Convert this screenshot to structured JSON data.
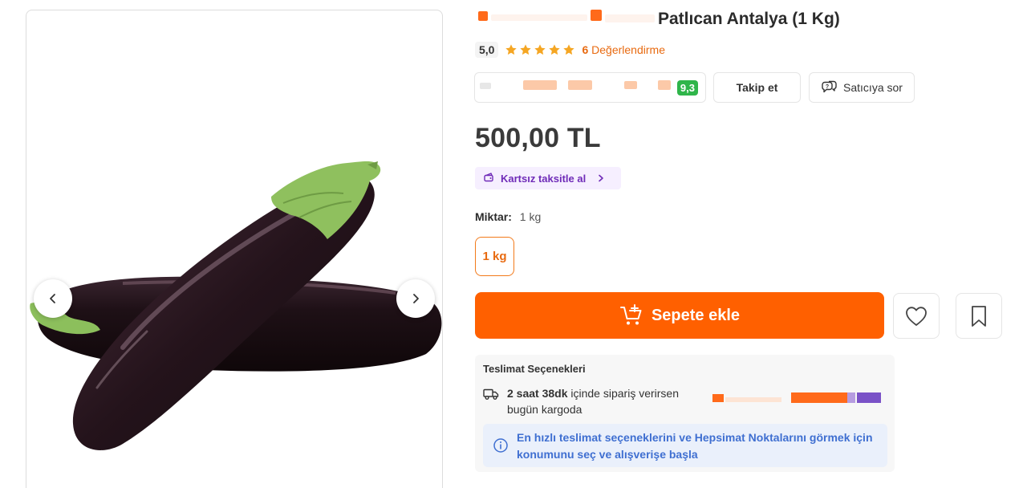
{
  "product": {
    "title": "Patlıcan Antalya (1 Kg)",
    "rating_score": "5,0",
    "rating_stars": 5,
    "review_count": "6",
    "review_label": "Değerlendirme",
    "price": "500,00 TL"
  },
  "seller": {
    "score": "9,3",
    "follow_label": "Takip et",
    "ask_label": "Satıcıya sor"
  },
  "installment": {
    "label": "Kartsız taksitle al"
  },
  "quantity": {
    "label": "Miktar:",
    "value": "1 kg",
    "options": [
      "1 kg"
    ]
  },
  "cart": {
    "add_label": "Sepete ekle"
  },
  "delivery": {
    "title": "Teslimat Seçenekleri",
    "time_bold": "2 saat 38dk",
    "time_rest": "içinde sipariş verirsen",
    "time_line2": "bugün kargoda",
    "info_part1": "En hızlı teslimat seçeneklerini ve ",
    "info_link": "Hepsimat Noktalarını",
    "info_part2": " görmek için",
    "info_line2": "konumunu seç ve alışverişe başla"
  },
  "colors": {
    "accent": "#ff6000",
    "star": "#f5a623",
    "seller_score_bg": "#2fb54a",
    "installment_text": "#6f2bb8",
    "info_text": "#3f6fd1"
  },
  "icons": [
    "chevron-left-icon",
    "chevron-right-icon",
    "star-icon",
    "chat-question-icon",
    "wallet-icon",
    "cart-plus-icon",
    "heart-icon",
    "bookmark-icon",
    "truck-icon",
    "info-icon"
  ]
}
